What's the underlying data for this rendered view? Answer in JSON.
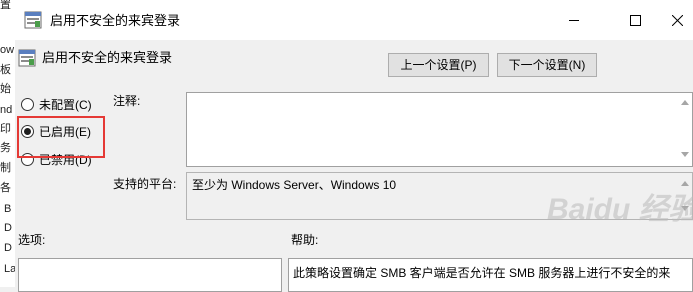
{
  "background_window": {
    "fragments": [
      "置",
      "ow",
      "板",
      "始",
      "nd",
      "印",
      "务",
      "制",
      "各",
      "B",
      "D",
      "D",
      "La"
    ]
  },
  "titlebar": {
    "title": "启用不安全的来宾登录"
  },
  "header": {
    "policy_name": "启用不安全的来宾登录",
    "prev_button": "上一个设置(P)",
    "next_button": "下一个设置(N)"
  },
  "state": {
    "options": [
      "未配置(C)",
      "已启用(E)",
      "已禁用(D)"
    ],
    "selected": "已启用(E)"
  },
  "labels": {
    "comment": "注释:",
    "supported_on": "支持的平台:",
    "options": "选项:",
    "help": "帮助:"
  },
  "fields": {
    "comment_value": "",
    "supported_on_value": "至少为 Windows Server、Windows 10",
    "help_text": "此策略设置确定 SMB 客户端是否允许在 SMB 服务器上进行不安全的来"
  },
  "watermark": {
    "text": "Baidu 经验"
  },
  "colors": {
    "highlight_box": "#e53935",
    "dialog_background": "#f0f0f0"
  }
}
